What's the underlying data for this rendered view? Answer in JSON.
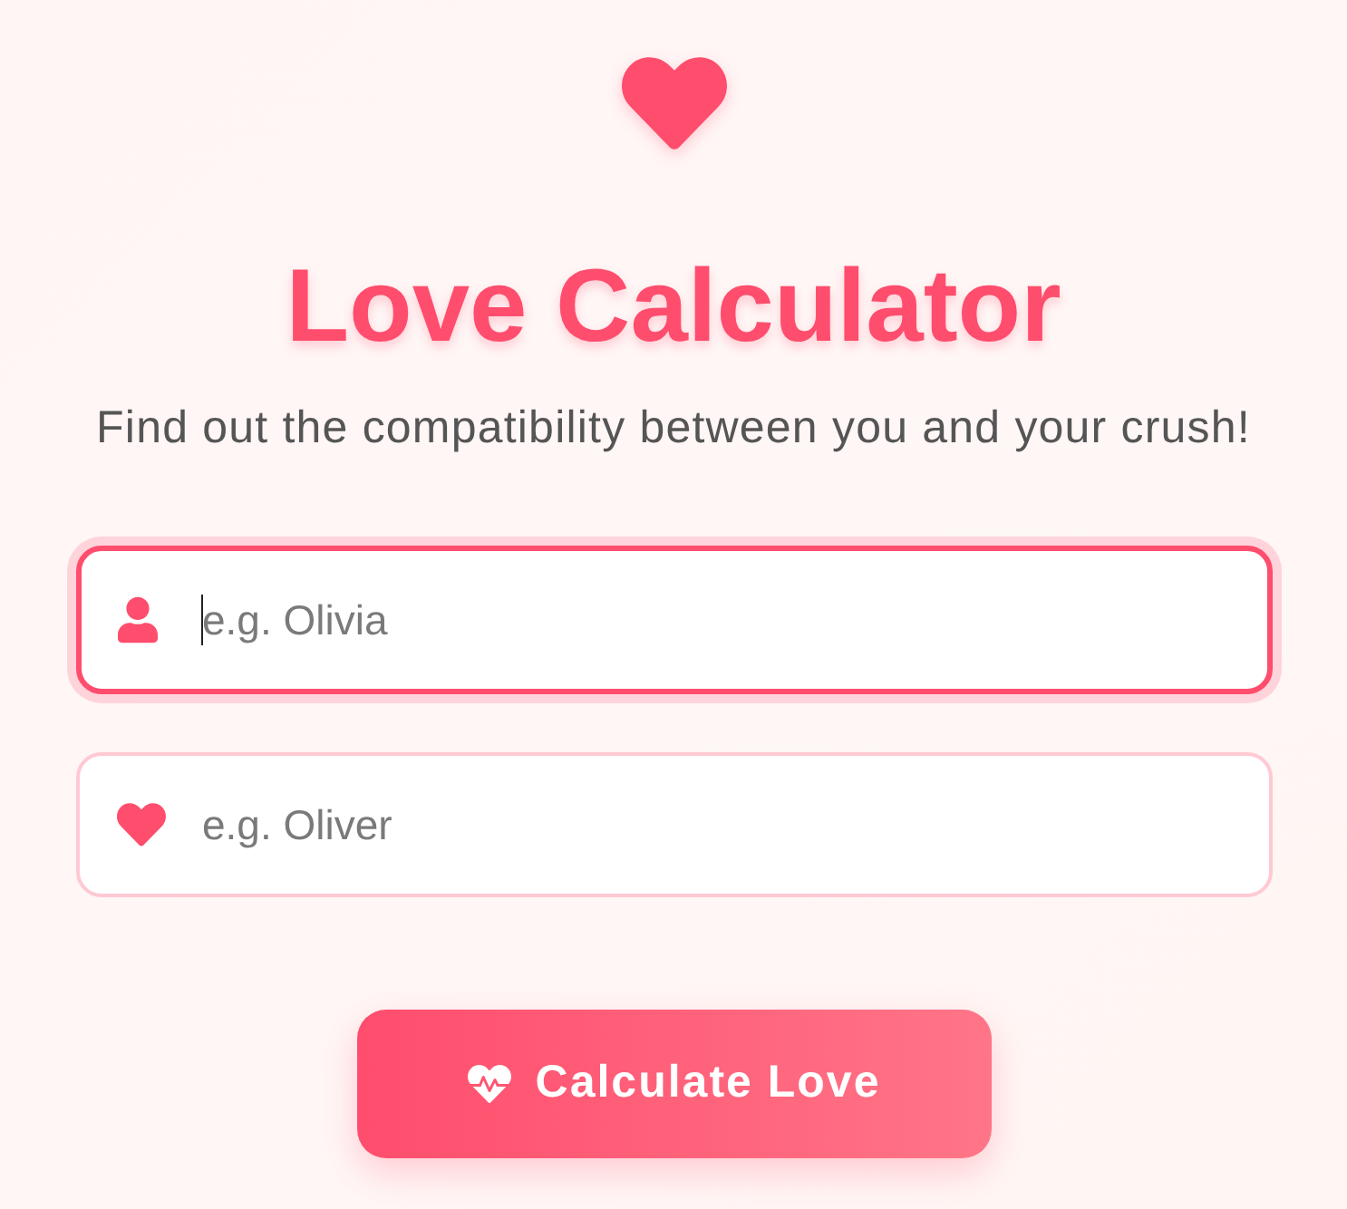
{
  "title": "Love Calculator",
  "subtitle": "Find out the compatibility between you and your crush!",
  "fields": [
    {
      "kind": "person",
      "placeholder": "e.g. Olivia",
      "focused": true
    },
    {
      "kind": "heart",
      "placeholder": "e.g. Oliver",
      "focused": false
    }
  ],
  "button": {
    "label": "Calculate Love"
  }
}
